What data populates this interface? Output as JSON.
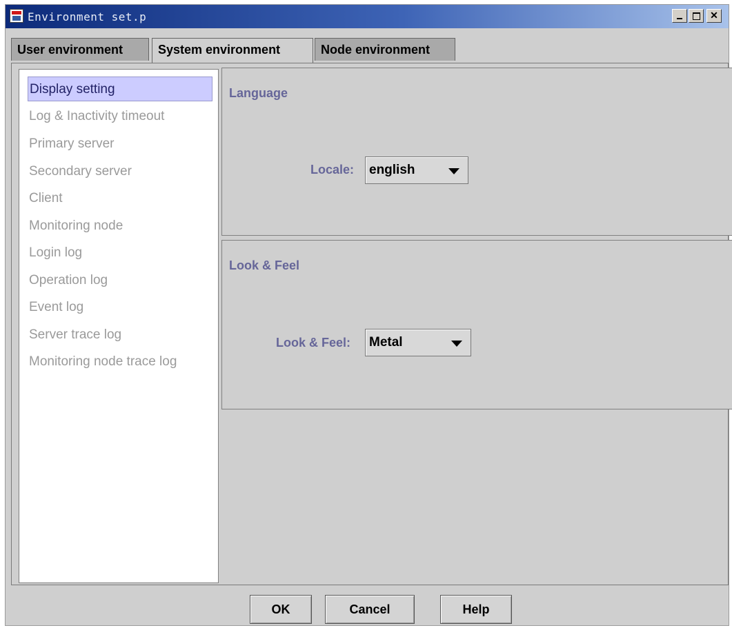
{
  "window": {
    "title": "Environment set.p"
  },
  "tabs": [
    {
      "label": "User environment",
      "active": false
    },
    {
      "label": "System environment",
      "active": true
    },
    {
      "label": "Node environment",
      "active": false
    }
  ],
  "sidebar": {
    "items": [
      {
        "label": "Display setting",
        "selected": true
      },
      {
        "label": "Log & Inactivity timeout"
      },
      {
        "label": "Primary server"
      },
      {
        "label": "Secondary server"
      },
      {
        "label": "Client"
      },
      {
        "label": "Monitoring node"
      },
      {
        "label": "Login log"
      },
      {
        "label": "Operation log"
      },
      {
        "label": "Event log"
      },
      {
        "label": "Server trace log"
      },
      {
        "label": "Monitoring node trace log"
      }
    ]
  },
  "language_panel": {
    "title": "Language",
    "locale_label": "Locale:",
    "locale_value": "english"
  },
  "look_panel": {
    "title": "Look & Feel",
    "look_label": "Look & Feel:",
    "look_value": "Metal"
  },
  "buttons": {
    "ok": "OK",
    "cancel": "Cancel",
    "help": "Help"
  },
  "colors": {
    "titlebar_start": "#0c2a7a",
    "selected_item": "#ccccff",
    "label_text": "#666699"
  },
  "icons": [
    "app-icon",
    "minimize-icon",
    "maximize-icon",
    "close-icon",
    "chevron-down-icon"
  ]
}
